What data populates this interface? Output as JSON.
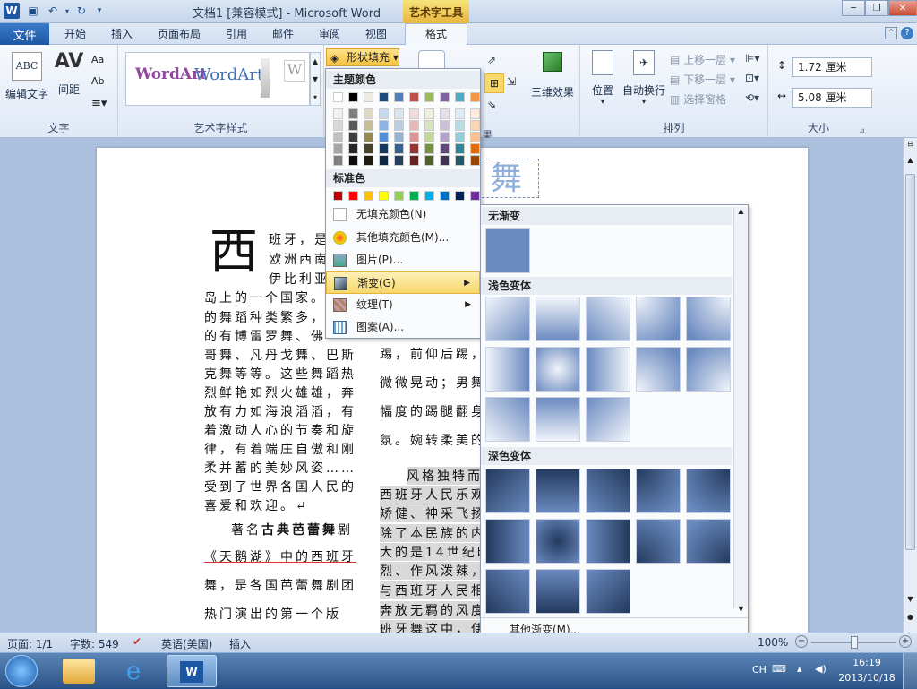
{
  "window": {
    "title": "文档1 [兼容模式] - Microsoft Word",
    "context_tab": "艺术字工具"
  },
  "tabs": [
    "开始",
    "插入",
    "页面布局",
    "引用",
    "邮件",
    "审阅",
    "视图"
  ],
  "file_tab": "文件",
  "format_tab": "格式",
  "ribbon": {
    "text_group": {
      "label": "文字",
      "edit_text": "编辑文字",
      "spacing": "间距"
    },
    "wordart_group": {
      "label": "艺术字样式",
      "sample1": "WordArt",
      "sample2": "WordArt",
      "sample3": "W"
    },
    "shape_fill": "形状填充",
    "effects_3d": "三维效果",
    "arrange_group": {
      "label": "排列",
      "position": "位置",
      "auto_wrap": "自动换行",
      "bring_forward": "上移一层",
      "send_backward": "下移一层",
      "selection_pane": "选择窗格"
    },
    "size_group": {
      "label": "大小",
      "height": "1.72 厘米",
      "width": "5.08 厘米"
    },
    "partial_label": "果"
  },
  "fill_menu": {
    "theme_colors_header": "主题颜色",
    "standard_colors_header": "标准色",
    "theme_top": [
      "#ffffff",
      "#000000",
      "#eeece1",
      "#1f497d",
      "#4f81bd",
      "#c0504d",
      "#9bbb59",
      "#8064a2",
      "#4bacc6",
      "#f79646"
    ],
    "theme_columns": [
      [
        "#f2f2f2",
        "#d8d8d8",
        "#bfbfbf",
        "#a5a5a5",
        "#7f7f7f"
      ],
      [
        "#7f7f7f",
        "#595959",
        "#3f3f3f",
        "#262626",
        "#0c0c0c"
      ],
      [
        "#ddd9c3",
        "#c4bd97",
        "#938953",
        "#494429",
        "#1d1b10"
      ],
      [
        "#c6d9f0",
        "#8db3e2",
        "#548dd4",
        "#17365d",
        "#0f243e"
      ],
      [
        "#dbe5f1",
        "#b8cce4",
        "#95b3d7",
        "#366092",
        "#244061"
      ],
      [
        "#f2dcdb",
        "#e5b9b7",
        "#d99694",
        "#953734",
        "#632423"
      ],
      [
        "#ebf1dd",
        "#d7e3bc",
        "#c3d69b",
        "#76923c",
        "#4f6128"
      ],
      [
        "#e5e0ec",
        "#ccc1d9",
        "#b2a2c7",
        "#5f497a",
        "#3f3151"
      ],
      [
        "#dbeef3",
        "#b7dde8",
        "#92cddc",
        "#31859b",
        "#205867"
      ],
      [
        "#fdeada",
        "#fbd5b5",
        "#fac08f",
        "#e36c09",
        "#974806"
      ]
    ],
    "standard": [
      "#c00000",
      "#ff0000",
      "#ffc000",
      "#ffff00",
      "#92d050",
      "#00b050",
      "#00b0f0",
      "#0070c0",
      "#002060",
      "#7030a0"
    ],
    "items": {
      "no_fill": "无填充颜色(N)",
      "more_colors": "其他填充颜色(M)...",
      "picture": "图片(P)...",
      "gradient": "渐变(G)",
      "texture": "纹理(T)",
      "pattern": "图案(A)..."
    }
  },
  "gradient_panel": {
    "no_gradient": "无渐变",
    "light_variants": "浅色变体",
    "dark_variants": "深色变体",
    "more_gradients": "其他渐变(M)..."
  },
  "document": {
    "dropcap": "西",
    "left_lines": [
      "班牙，是位",
      "欧洲西南",
      "伊比利亚",
      "岛上的一个国家。",
      "的舞蹈种类繁多，",
      "的有博雷罗舞、佛",
      "哥舞、凡丹戈舞、巴斯",
      "克舞等等。这些舞蹈热",
      "烈鲜艳如烈火雄雄，奔",
      "放有力如海浪滔滔，有",
      "着激动人心的节奏和旋",
      "律，有着端庄自傲和刚",
      "柔并蓄的美妙风姿……",
      "受到了世界各国人民的",
      "喜爱和欢迎。↵"
    ],
    "famous_line_prefix": "著名",
    "famous_line_bold": "古典芭蕾舞",
    "famous_line_suffix": "剧",
    "swan_line": "《天鹅湖》中的西班牙",
    "line_b2": "舞，是各国芭蕾舞剧团",
    "line_b3": "热门演出的第一个版",
    "right_lines": [
      "踢，前仰后踢，",
      "微微晃动；男舞",
      "幅度的踢腿翻身",
      "氛。婉转柔美的"
    ],
    "right_lines2": [
      "风格独特而",
      "西班牙人民乐观",
      "矫健、神采飞扬",
      "除了本民族的内",
      "大的是14世纪时",
      "烈、作风泼辣，",
      "与西班牙人民相",
      "奔放无羁的风度",
      "班牙舞这中，使"
    ],
    "wordart_text": "舞"
  },
  "status": {
    "page": "页面: 1/1",
    "words": "字数: 549",
    "language": "英语(美国)",
    "insert": "插入",
    "zoom": "100%"
  },
  "taskbar": {
    "ime": "CH",
    "time": "16:19",
    "date": "2013/10/18"
  },
  "colors": {
    "accent": "#1d56a3",
    "highlight": "#f7d86b",
    "gradient_blue": "#6a8ac0"
  }
}
